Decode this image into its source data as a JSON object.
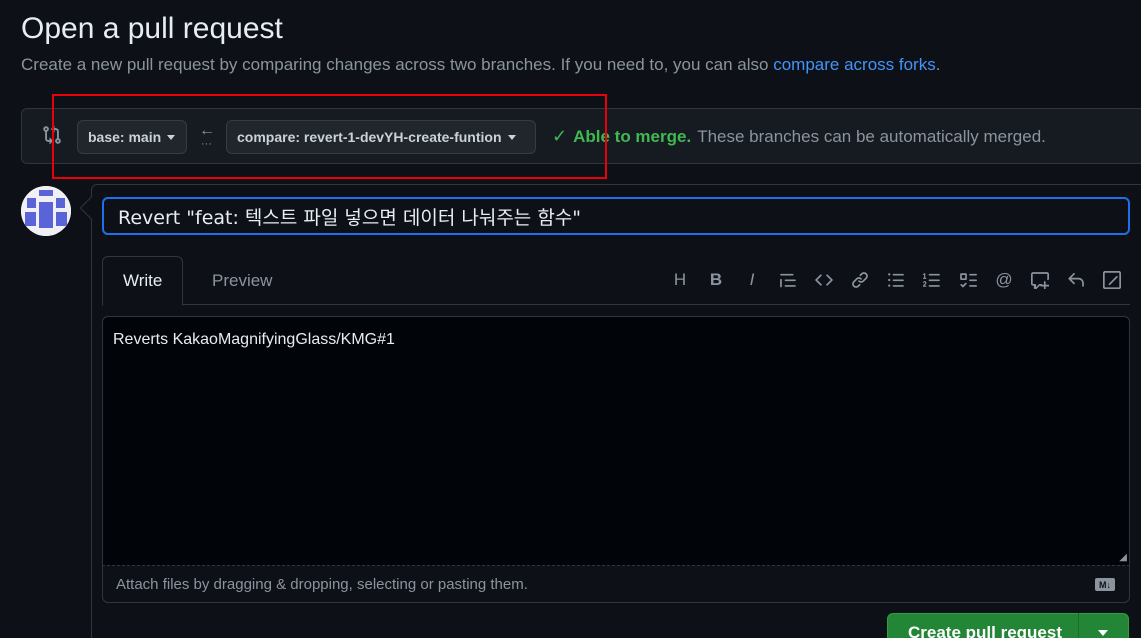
{
  "page": {
    "title": "Open a pull request",
    "subtitle_text": "Create a new pull request by comparing changes across two branches. If you need to, you can also ",
    "subtitle_link": "compare across forks",
    "subtitle_end": "."
  },
  "range": {
    "base_label": "base: main",
    "compare_label": "compare: revert-1-devYH-create-funtion",
    "able_label": "Able to merge.",
    "merge_text": "These branches can be automatically merged."
  },
  "form": {
    "title_value": "Revert \"feat: 텍스트 파일 넣으면 데이터 나눠주는 함수\"",
    "tabs": [
      {
        "label": "Write"
      },
      {
        "label": "Preview"
      }
    ],
    "toolbar": [
      "heading-icon",
      "bold-icon",
      "italic-icon",
      "quote-icon",
      "code-icon",
      "link-icon",
      "unordered-list-icon",
      "ordered-list-icon",
      "task-list-icon",
      "mention-icon",
      "reference-icon",
      "undo-icon",
      "slash-command-icon"
    ],
    "body_value": "Reverts KakaoMagnifyingGlass/KMG#1",
    "attach_text": "Attach files by dragging & dropping, selecting or pasting them.",
    "markdown_badge": "M↓"
  },
  "actions": {
    "create_label": "Create pull request"
  },
  "colors": {
    "background": "#0d1117",
    "accent_blue": "#4493f8",
    "success_green": "#3fb950",
    "button_green": "#238636",
    "highlight_red": "#e8000b"
  }
}
